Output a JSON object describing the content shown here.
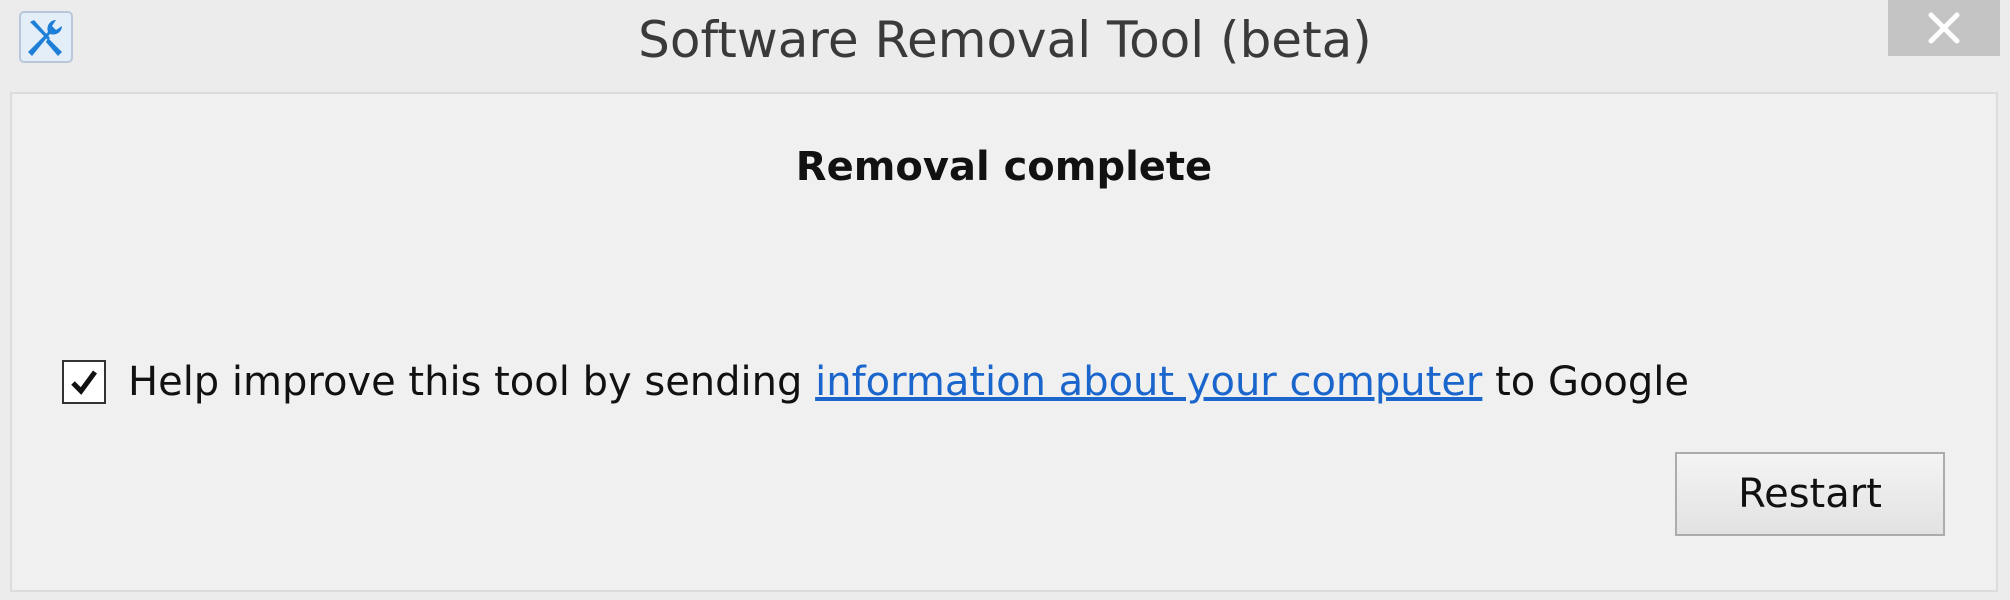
{
  "window": {
    "title": "Software Removal Tool (beta)",
    "app_icon": "tools-icon",
    "close_icon": "close-icon"
  },
  "dialog": {
    "heading": "Removal complete",
    "consent": {
      "checked": true,
      "text_before": "Help improve this tool by sending ",
      "link_text": "information about your computer",
      "text_after": " to Google"
    },
    "restart_label": "Restart"
  },
  "colors": {
    "link": "#1a66cc",
    "icon_blue": "#1e7fd8"
  }
}
